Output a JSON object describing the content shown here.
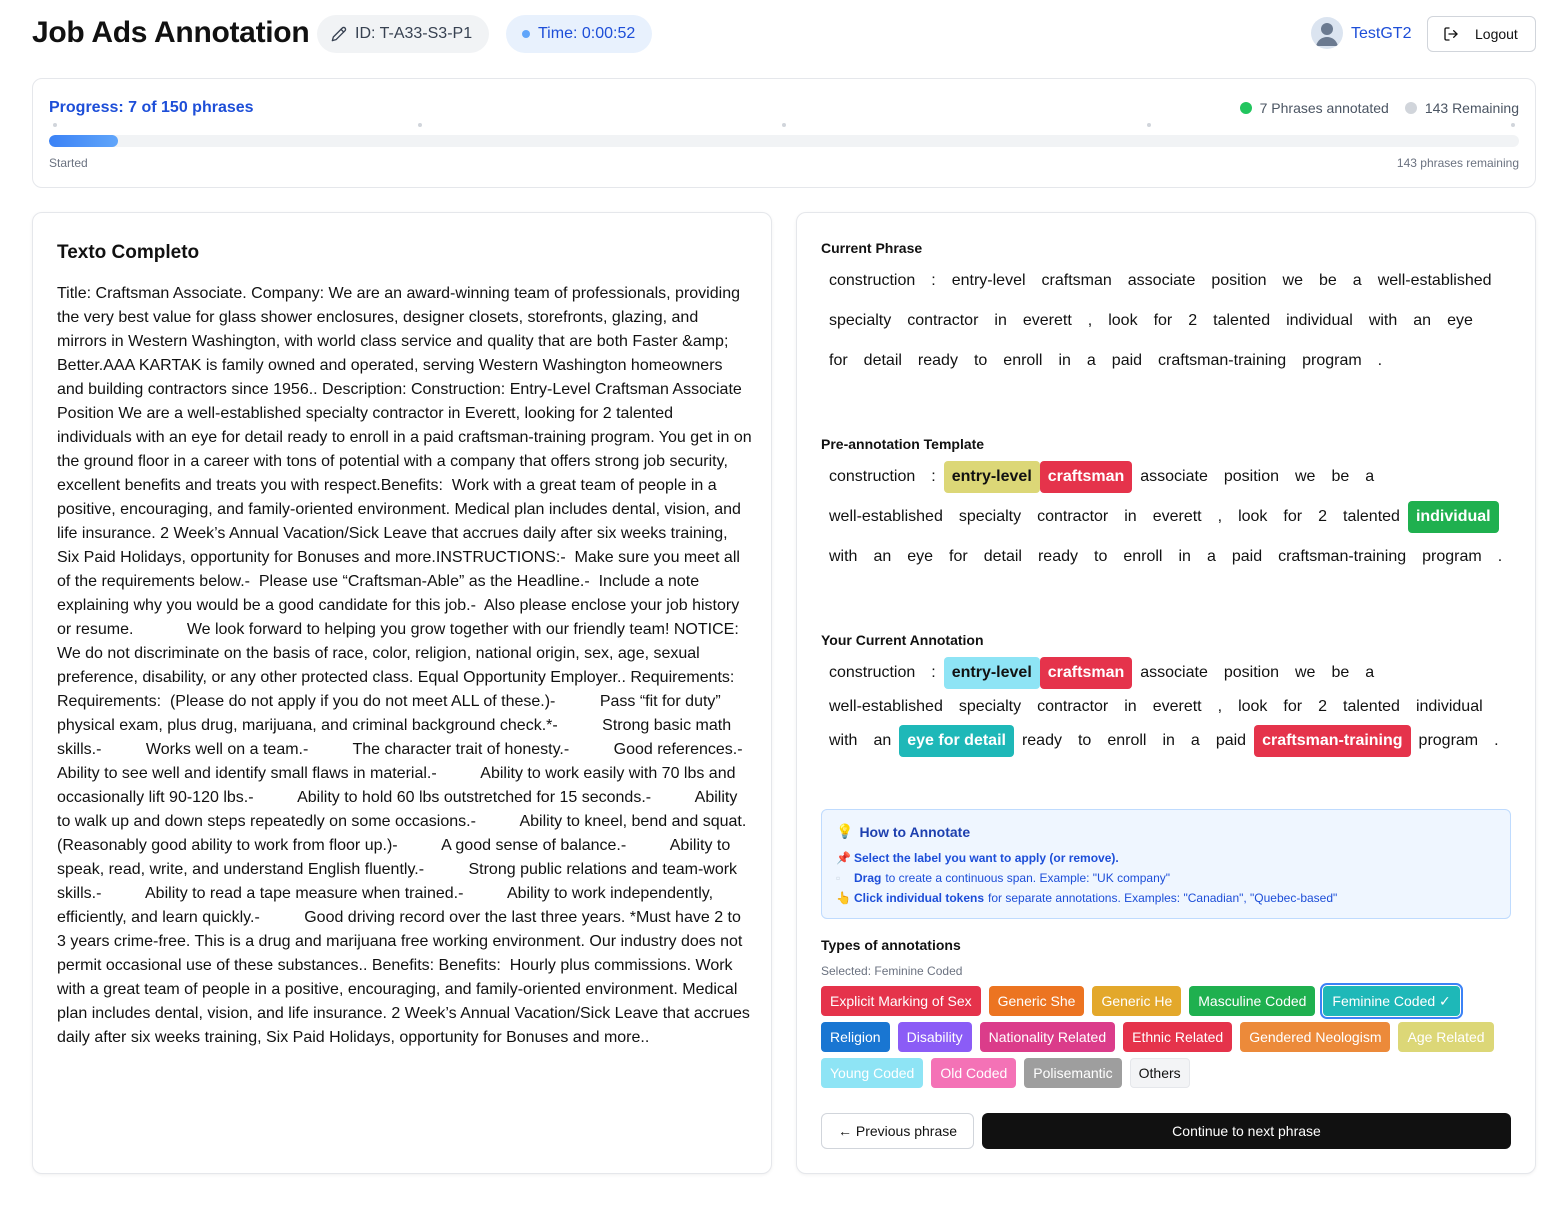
{
  "header": {
    "title": "Job Ads Annotation",
    "id_label": "ID: T-A33-S3-P1",
    "time_label": "Time: 0:00:52",
    "user_name": "TestGT2",
    "logout_label": "Logout"
  },
  "progress": {
    "title": "Progress: 7 of 150 phrases",
    "annotated_label": "7 Phrases annotated",
    "remaining_label": "143 Remaining",
    "started_label": "Started",
    "remaining_text": "143 phrases remaining",
    "fraction": 0.047,
    "colors": {
      "annotated": "#22c55e",
      "remaining": "#d1d5db",
      "bar": "#3b82f6"
    }
  },
  "full_text": {
    "title": "Texto Completo",
    "body": "Title: Craftsman Associate. Company: We are an award-winning team of professionals, providing the very best value for glass shower enclosures, designer closets, storefronts, glazing, and mirrors in Western Washington, with world class service and quality that are both Faster &amp; Better.AAA KARTAK is family owned and operated, serving Western Washington homeowners and building contractors since 1956.. Description: Construction: Entry-Level Craftsman Associate Position We are a well-established specialty contractor in Everett, looking for 2 talented individuals with an eye for detail ready to enroll in a paid craftsman-training program. You get in on the ground floor in a career with tons of potential with a company that offers strong job security, excellent benefits and treats you with respect.Benefits:  Work with a great team of people in a positive, encouraging, and family-oriented environment. Medical plan includes dental, vision, and life insurance. 2 Week’s Annual Vacation/Sick Leave that accrues daily after six weeks training, Six Paid Holidays, opportunity for Bonuses and more.INSTRUCTIONS:-  Make sure you meet all of the requirements below.-  Please use “Craftsman-Able” as the Headline.-  Include a note explaining why you would be a good candidate for this job.-  Also please enclose your job history or resume.            We look forward to helping you grow together with our friendly team! NOTICE: We do not discriminate on the basis of race, color, religion, national origin, sex, age, sexual preference, disability, or any other protected class. Equal Opportunity Employer.. Requirements: Requirements:  (Please do not apply if you do not meet ALL of these.)-          Pass “fit for duty” physical exam, plus drug, marijuana, and criminal background check.*-          Strong basic math skills.-          Works well on a team.-          The character trait of honesty.-          Good references.-          Ability to see well and identify small flaws in material.-          Ability to work easily with 70 lbs and occasionally lift 90-120 lbs.-          Ability to hold 60 lbs outstretched for 15 seconds.-          Ability to walk up and down steps repeatedly on some occasions.-          Ability to kneel, bend and squat. (Reasonably good ability to work from floor up.)-          A good sense of balance.-          Ability to speak, read, write, and understand English fluently.-          Strong public relations and team-work skills.-          Ability to read a tape measure when trained.-          Ability to work independently, efficiently, and learn quickly.-          Good driving record over the last three years. *Must have 2 to 3 years crime-free. This is a drug and marijuana free working environment. Our industry does not permit occasional use of these substances.. Benefits: Benefits:  Hourly plus commissions. Work with a great team of people in a positive, encouraging, and family-oriented environment. Medical plan includes dental, vision, and life insurance. 2 Week’s Annual Vacation/Sick Leave that accrues daily after six weeks training, Six Paid Holidays, opportunity for Bonuses and more.."
  },
  "current_phrase": {
    "title": "Current Phrase",
    "tokens": [
      {
        "t": "construction"
      },
      {
        "t": ":"
      },
      {
        "t": "entry-level"
      },
      {
        "t": "craftsman"
      },
      {
        "t": "associate"
      },
      {
        "t": "position"
      },
      {
        "t": "we"
      },
      {
        "t": "be"
      },
      {
        "t": "a"
      },
      {
        "t": "well-established"
      },
      {
        "t": "specialty"
      },
      {
        "t": "contractor"
      },
      {
        "t": "in"
      },
      {
        "t": "everett"
      },
      {
        "t": ","
      },
      {
        "t": "look"
      },
      {
        "t": "for"
      },
      {
        "t": "2"
      },
      {
        "t": "talented"
      },
      {
        "t": "individual"
      },
      {
        "t": "with"
      },
      {
        "t": "an"
      },
      {
        "t": "eye"
      },
      {
        "t": "for"
      },
      {
        "t": "detail"
      },
      {
        "t": "ready"
      },
      {
        "t": "to"
      },
      {
        "t": "enroll"
      },
      {
        "t": "in"
      },
      {
        "t": "a"
      },
      {
        "t": "paid"
      },
      {
        "t": "craftsman-training"
      },
      {
        "t": "program"
      },
      {
        "t": "."
      }
    ]
  },
  "pre_annotation": {
    "title": "Pre-annotation Template",
    "tokens": [
      {
        "t": "construction"
      },
      {
        "t": ":"
      },
      {
        "t": "entry-level",
        "bg": "#dcd777",
        "fg": "#111111"
      },
      {
        "t": "craftsman",
        "bg": "#e5334b",
        "fg": "#ffffff"
      },
      {
        "t": "associate"
      },
      {
        "t": "position"
      },
      {
        "t": "we"
      },
      {
        "t": "be"
      },
      {
        "t": "a"
      },
      {
        "t": "well-established"
      },
      {
        "t": "specialty"
      },
      {
        "t": "contractor"
      },
      {
        "t": "in"
      },
      {
        "t": "everett"
      },
      {
        "t": ","
      },
      {
        "t": "look"
      },
      {
        "t": "for"
      },
      {
        "t": "2"
      },
      {
        "t": "talented"
      },
      {
        "t": "individual",
        "bg": "#1fb04f",
        "fg": "#ffffff"
      },
      {
        "t": "with"
      },
      {
        "t": "an"
      },
      {
        "t": "eye"
      },
      {
        "t": "for"
      },
      {
        "t": "detail"
      },
      {
        "t": "ready"
      },
      {
        "t": "to"
      },
      {
        "t": "enroll"
      },
      {
        "t": "in"
      },
      {
        "t": "a"
      },
      {
        "t": "paid"
      },
      {
        "t": "craftsman-training"
      },
      {
        "t": "program"
      },
      {
        "t": "."
      }
    ]
  },
  "current_annotation": {
    "title": "Your Current Annotation",
    "tokens": [
      {
        "t": "construction"
      },
      {
        "t": ":"
      },
      {
        "t": "entry-level",
        "bg": "#8ee4f5",
        "fg": "#111111"
      },
      {
        "t": "craftsman",
        "bg": "#e5334b",
        "fg": "#ffffff"
      },
      {
        "t": "associate"
      },
      {
        "t": "position"
      },
      {
        "t": "we"
      },
      {
        "t": "be"
      },
      {
        "t": "a"
      },
      {
        "t": "well-established"
      },
      {
        "t": "specialty"
      },
      {
        "t": "contractor"
      },
      {
        "t": "in"
      },
      {
        "t": "everett"
      },
      {
        "t": ","
      },
      {
        "t": "look"
      },
      {
        "t": "for"
      },
      {
        "t": "2"
      },
      {
        "t": "talented"
      },
      {
        "t": "individual"
      },
      {
        "t": "with"
      },
      {
        "t": "an"
      },
      {
        "t": "eye   for   detail",
        "bg": "#1eb8b8",
        "fg": "#ffffff"
      },
      {
        "t": "ready"
      },
      {
        "t": "to"
      },
      {
        "t": "enroll"
      },
      {
        "t": "in"
      },
      {
        "t": "a"
      },
      {
        "t": "paid"
      },
      {
        "t": "craftsman-training",
        "bg": "#e5334b",
        "fg": "#ffffff"
      },
      {
        "t": "program"
      },
      {
        "t": "."
      }
    ]
  },
  "howto": {
    "title": "How to Annotate",
    "title_icon": "lightbulb-icon",
    "lines": [
      {
        "icon": "pin-icon",
        "bold": "Select the label you want to apply (or remove).",
        "text": ""
      },
      {
        "icon": "drag-icon",
        "bold": "Drag",
        "text": "to create a continuous span. Example: \"UK company\""
      },
      {
        "icon": "pointer-icon",
        "bold": "Click individual tokens",
        "text": "for separate annotations. Examples: \"Canadian\", \"Quebec-based\""
      }
    ]
  },
  "types": {
    "title": "Types of annotations",
    "selected_label": "Selected: Feminine Coded",
    "labels": [
      {
        "name": "Explicit Marking of Sex",
        "bg": "#e5334b",
        "fg": "#ffffff"
      },
      {
        "name": "Generic She",
        "bg": "#ec7421",
        "fg": "#ffffff"
      },
      {
        "name": "Generic He",
        "bg": "#e3a82b",
        "fg": "#ffffff"
      },
      {
        "name": "Masculine Coded",
        "bg": "#1fb04f",
        "fg": "#ffffff"
      },
      {
        "name": "Feminine Coded ✓",
        "bg": "#1eb8b8",
        "fg": "#ffffff",
        "selected": true
      },
      {
        "name": "Religion",
        "bg": "#1976d2",
        "fg": "#ffffff"
      },
      {
        "name": "Disability",
        "bg": "#8b5cf6",
        "fg": "#ffffff"
      },
      {
        "name": "Nationality Related",
        "bg": "#db3c8a",
        "fg": "#ffffff"
      },
      {
        "name": "Ethnic Related",
        "bg": "#e5334b",
        "fg": "#ffffff"
      },
      {
        "name": "Gendered Neologism",
        "bg": "#ec8a3a",
        "fg": "#ffffff"
      },
      {
        "name": "Age Related",
        "bg": "#dcd777",
        "fg": "#ffffff"
      },
      {
        "name": "Young Coded",
        "bg": "#8ee4f5",
        "fg": "#ffffff"
      },
      {
        "name": "Old Coded",
        "bg": "#f472b6",
        "fg": "#ffffff"
      },
      {
        "name": "Polisemantic",
        "bg": "#9e9e9e",
        "fg": "#ffffff"
      },
      {
        "name": "Others",
        "bg": "#f3f4f6",
        "fg": "#111111",
        "border": "#e5e7eb"
      }
    ]
  },
  "nav": {
    "prev_label": "← Previous phrase",
    "next_label": "Continue to next phrase"
  }
}
